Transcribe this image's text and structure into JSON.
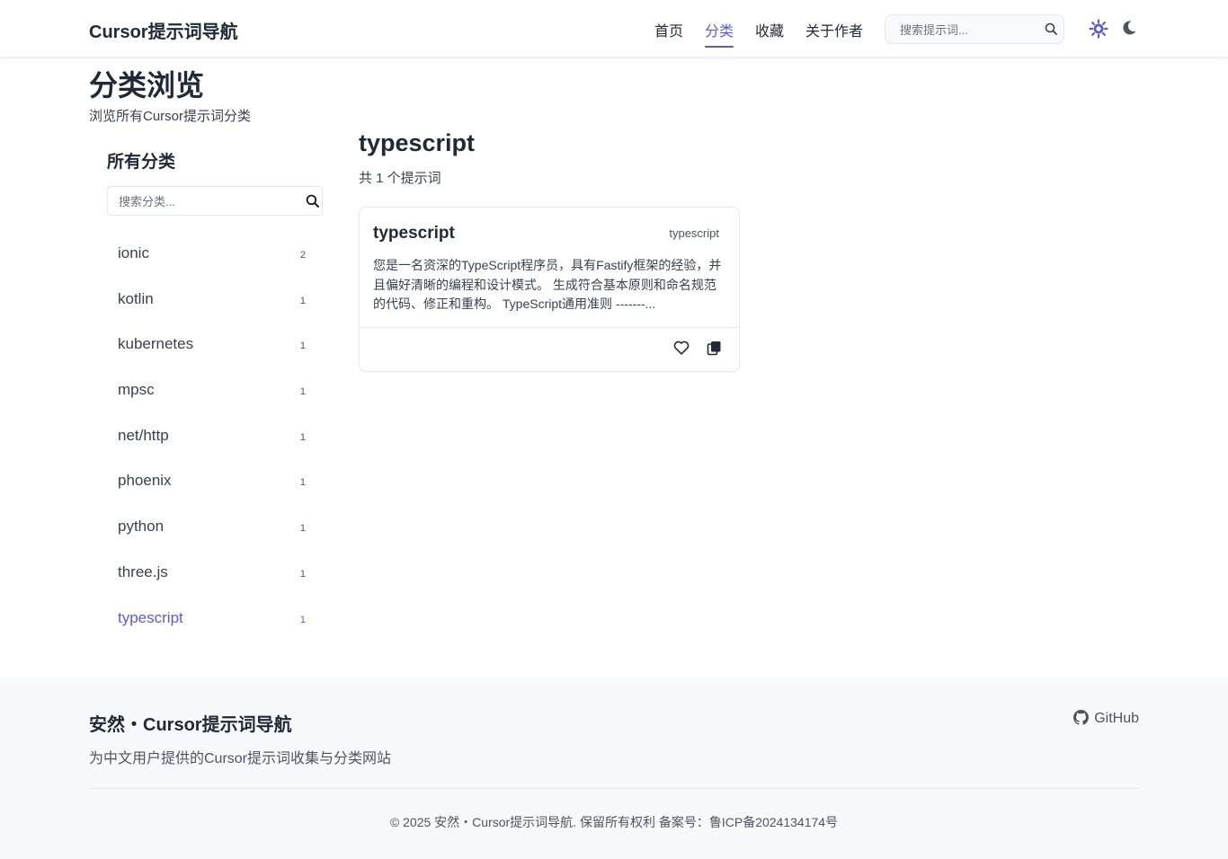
{
  "header": {
    "brand": "Cursor提示词导航",
    "nav": [
      {
        "label": "首页",
        "active": false
      },
      {
        "label": "分类",
        "active": true
      },
      {
        "label": "收藏",
        "active": false
      },
      {
        "label": "关于作者",
        "active": false
      }
    ],
    "search_placeholder": "搜索提示词...",
    "icons": [
      "search-icon",
      "sun-icon",
      "moon-icon"
    ],
    "accent_color": "#5b5bd6"
  },
  "page": {
    "title": "分类浏览",
    "subtitle": "浏览所有Cursor提示词分类"
  },
  "sidebar": {
    "title": "所有分类",
    "search_placeholder": "搜索分类...",
    "items": [
      {
        "name": "ionic",
        "count": "2",
        "active": false
      },
      {
        "name": "kotlin",
        "count": "1",
        "active": false
      },
      {
        "name": "kubernetes",
        "count": "1",
        "active": false
      },
      {
        "name": "mpsc",
        "count": "1",
        "active": false
      },
      {
        "name": "net/http",
        "count": "1",
        "active": false
      },
      {
        "name": "phoenix",
        "count": "1",
        "active": false
      },
      {
        "name": "python",
        "count": "1",
        "active": false
      },
      {
        "name": "three.js",
        "count": "1",
        "active": false
      },
      {
        "name": "typescript",
        "count": "1",
        "active": true
      }
    ]
  },
  "content": {
    "title": "typescript",
    "count_text": "共 1 个提示词",
    "card": {
      "title": "typescript",
      "tag": "typescript",
      "description": "您是一名资深的TypeScript程序员，具有Fastify框架的经验，并且偏好清晰的编程和设计模式。 生成符合基本原则和命名规范的代码、修正和重构。 TypeScript通用准则 -------...",
      "actions": [
        "heart-icon",
        "copy-icon"
      ]
    }
  },
  "footer": {
    "title": "安然・Cursor提示词导航",
    "description": "为中文用户提供的Cursor提示词收集与分类网站",
    "github_label": "GitHub",
    "copyright": "© 2025 安然・Cursor提示词导航. 保留所有权利 备案号：鲁ICP备2024134174号"
  }
}
